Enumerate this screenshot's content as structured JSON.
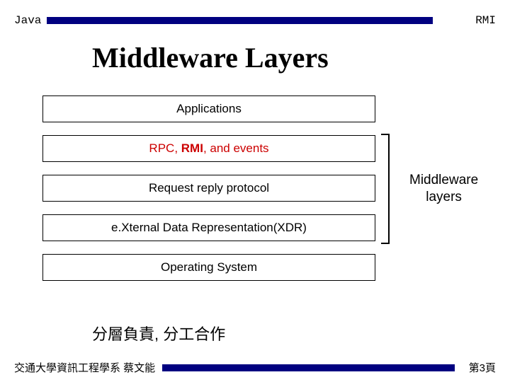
{
  "header": {
    "left": "Java",
    "right": "RMI"
  },
  "title": "Middleware Layers",
  "layers": {
    "applications": "Applications",
    "rpc_prefix": "RPC, ",
    "rpc_bold": "RMI",
    "rpc_suffix": ", and events",
    "request_reply": "Request reply protocol",
    "xdr": "e.Xternal Data Representation(XDR)",
    "os": "Operating System"
  },
  "bracket_label_line1": "Middleware",
  "bracket_label_line2": "layers",
  "cjk_caption": "分層負責, 分工合作",
  "footer": {
    "left": "交通大學資訊工程學系 蔡文能",
    "right": "第3頁"
  }
}
